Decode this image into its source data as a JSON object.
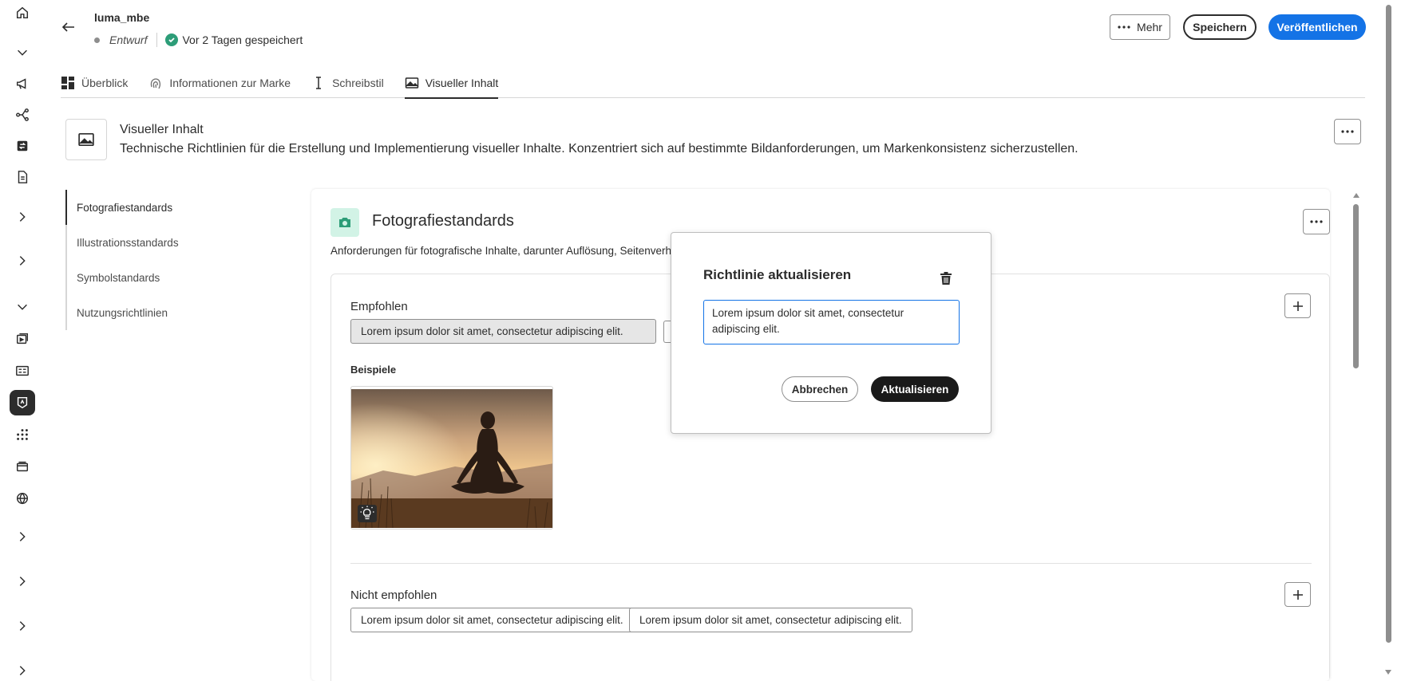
{
  "header": {
    "title": "luma_mbe",
    "status_draft": "Entwurf",
    "saved_text": "Vor 2 Tagen gespeichert",
    "more_label": "Mehr",
    "save_label": "Speichern",
    "publish_label": "Veröffentlichen"
  },
  "tabs": [
    {
      "label": "Überblick",
      "icon": "overview-grid-icon"
    },
    {
      "label": "Informationen zur Marke",
      "icon": "fingerprint-icon"
    },
    {
      "label": "Schreibstil",
      "icon": "text-cursor-icon"
    },
    {
      "label": "Visueller Inhalt",
      "icon": "image-icon",
      "active": true
    }
  ],
  "section": {
    "title": "Visueller Inhalt",
    "description": "Technische Richtlinien für die Erstellung und Implementierung visueller Inhalte. Konzentriert sich auf bestimmte Bildanforderungen, um Markenkonsistenz sicherzustellen."
  },
  "subnav": [
    {
      "label": "Fotografiestandards",
      "active": true
    },
    {
      "label": "Illustrationsstandards"
    },
    {
      "label": "Symbolstandards"
    },
    {
      "label": "Nutzungsrichtlinien"
    }
  ],
  "panel": {
    "title": "Fotografiestandards",
    "description": "Anforderungen für fotografische Inhalte, darunter Auflösung, Seitenverhältn",
    "recommended_heading": "Empfohlen",
    "recommended_chip": "Lorem ipsum dolor sit amet, consectetur adipiscing elit.",
    "examples_heading": "Beispiele",
    "not_recommended_heading": "Nicht empfohlen",
    "not_recommended_chips": [
      "Lorem ipsum dolor sit amet, consectetur adipiscing elit.",
      "Lorem ipsum dolor sit amet, consectetur adipiscing elit."
    ]
  },
  "popover": {
    "title": "Richtlinie aktualisieren",
    "textarea_value": "Lorem ipsum dolor sit amet, consectetur adipiscing elit.",
    "cancel_label": "Abbrechen",
    "update_label": "Aktualisieren"
  },
  "colors": {
    "accent_blue": "#1473e6",
    "success_green": "#2d9d78",
    "panel_icon_bg": "#d2f3e6"
  }
}
